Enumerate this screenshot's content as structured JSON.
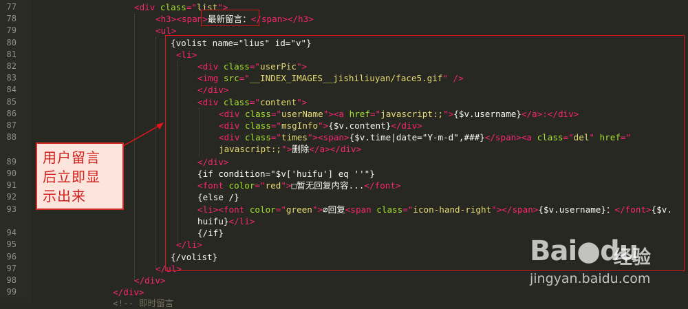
{
  "editor": {
    "line_numbers": [
      "77",
      "78",
      "79",
      "80",
      "81",
      "82",
      "83",
      "84",
      "85",
      "86",
      "87",
      "88",
      "89",
      "90",
      "91",
      "92",
      "93",
      "94",
      "95",
      "96",
      "97",
      "98",
      "99"
    ],
    "lines": {
      "l77": {
        "t1": "<div ",
        "a1": "class",
        "t2": "=\"",
        "s1": "list",
        "t3": "\">"
      },
      "l78": {
        "t1": "<h3><span>",
        "x1": "最新留言：",
        "t2": "</span></h3>"
      },
      "l79": {
        "t1": "<ul>"
      },
      "l80": {
        "x1": "{volist name=\"lius\" id=\"v\"}"
      },
      "l81": {
        "t1": "<li>"
      },
      "l82": {
        "t1": "<div ",
        "a1": "class",
        "t2": "=\"",
        "s1": "userPic",
        "t3": "\">"
      },
      "l83": {
        "t1": "<img ",
        "a1": "src",
        "t2": "=\"",
        "s1": "__INDEX_IMAGES__jishiliuyan/face5.gif",
        "t3": "\" />"
      },
      "l84": {
        "t1": "</div>"
      },
      "l85": {
        "t1": "<div ",
        "a1": "class",
        "t2": "=\"",
        "s1": "content",
        "t3": "\">"
      },
      "l86": {
        "t1": "<div ",
        "a1": "class",
        "t2": "=\"",
        "s1": "userName",
        "t3": "\"><a ",
        "a2": "href",
        "t4": "=\"",
        "s2": "javascript:;",
        "t5": "\">",
        "x1": "{$v.username}",
        "t6": "</a>:</div>"
      },
      "l87": {
        "t1": "<div ",
        "a1": "class",
        "t2": "=\"",
        "s1": "msgInfo",
        "t3": "\">",
        "x1": "{$v.content}",
        "t4": "</div>"
      },
      "l88": {
        "t1": "<div ",
        "a1": "class",
        "t2": "=\"",
        "s1": "times",
        "t3": "\"><span>",
        "x1": "{$v.time|date=\"Y-m-d\",###}",
        "t4": "</span><a ",
        "a2": "class",
        "t5": "=\"",
        "s2": "del",
        "t6": "\" ",
        "a3": "href",
        "t7": "=\""
      },
      "l88b": {
        "s1": "javascript:;",
        "t1": "\">",
        "x1": "删除",
        "t2": "</a></div>"
      },
      "l89": {
        "t1": "</div>"
      },
      "l90": {
        "x1": "{if condition=\"$v['huifu'] eq ''\"}"
      },
      "l91": {
        "t1": "<font ",
        "a1": "color",
        "t2": "=\"",
        "s1": "red",
        "t3": "\">",
        "x1": "□暂无回复内容...",
        "t4": "</font>"
      },
      "l92": {
        "x1": "{else /}"
      },
      "l93": {
        "t1": "<li><font ",
        "a1": "color",
        "t2": "=\"",
        "s1": "green",
        "t3": "\">",
        "x1": "∅回复",
        "t4": "<span ",
        "a2": "class",
        "t5": "=\"",
        "s2": "icon-hand-right",
        "t6": "\"></span>",
        "x2": "{$v.username}：",
        "t7": "</font>",
        "x3": "{$v."
      },
      "l93b": {
        "x1": "huifu}",
        "t1": "</li>"
      },
      "l94": {
        "x1": "{/if}"
      },
      "l95": {
        "t1": "</li>"
      },
      "l96": {
        "x1": "{/volist}"
      },
      "l97": {
        "t1": "</ul>"
      },
      "l98": {
        "t1": "</div>"
      },
      "l99": {
        "t1": "</div>"
      },
      "l100": {
        "x1": "<!-- 即时留言"
      }
    }
  },
  "callout": {
    "line1": "用户留言",
    "line2": "后立即显",
    "line3": "示出来"
  },
  "watermark": {
    "brand": "Bai●du",
    "cn": "经验",
    "url": "jingyan.baidu.com"
  },
  "colors": {
    "background": "#272822",
    "tag": "#f92672",
    "attribute": "#a6e22e",
    "string": "#e6db74",
    "highlight": "#e3141c"
  }
}
